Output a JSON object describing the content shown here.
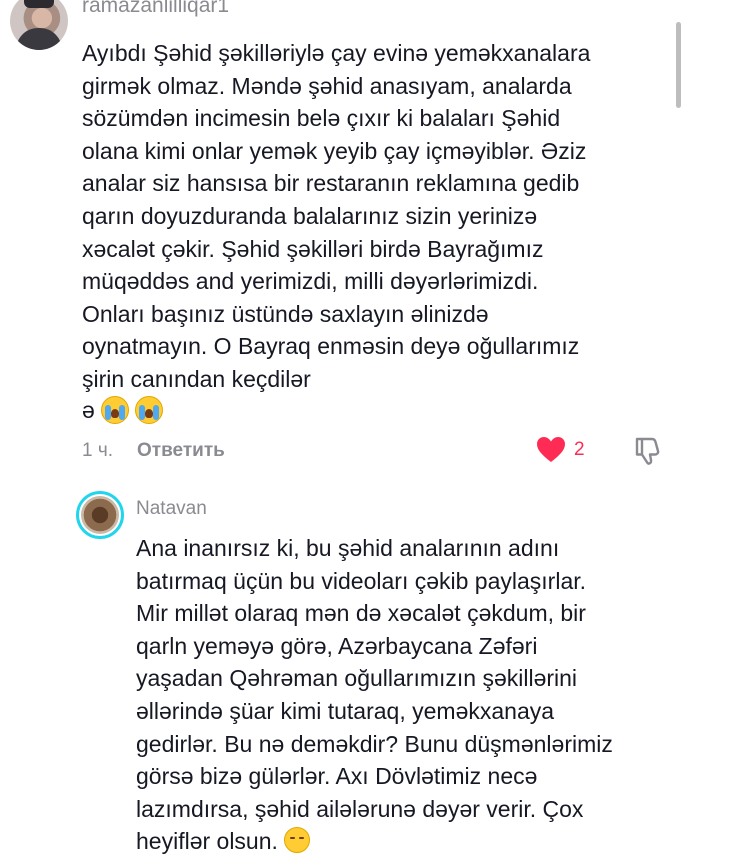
{
  "comment1": {
    "username": "ramazanlilliqar1",
    "lines": [
      "Ayıbdı Şəhid şəkilləriylə çay evinə yeməkxanalara",
      "girmək olmaz. Məndə şəhid anasıyam, analarda",
      "sözümdən incimesin belə çıxır ki balaları Şəhid",
      "olana kimi onlar yemək yeyib çay içməyiblər. Əziz",
      "analar siz hansısa bir restaranın reklamına gedib",
      "qarın doyuzduranda balalarınız sizin yerinizə",
      "xəcalət çəkir. Şəhid şəkilləri birdə Bayrağımız",
      "müqəddəs and yerimizdi, milli dəyərlərimizdi.",
      "Onları başınız üstündə saxlayın əlinizdə",
      "oynatmayın. O Bayraq enməsin deyə oğullarımız",
      "şirin canından keçdilər"
    ],
    "trailing_char": "ə",
    "time": "1 ч.",
    "reply_label": "Ответить",
    "like_count": "2"
  },
  "comment2": {
    "username": "Natavan",
    "lines": [
      "Ana inanırsız ki, bu şəhid analarının adını",
      "batırmaq üçün bu videoları çəkib paylaşırlar.",
      "Mir millət olaraq mən də xəcalət çəkdum, bir",
      "qarln yeməyə görə, Azərbaycana Zəfəri",
      "yaşadan Qəhrəman oğullarımızın şəkillərini",
      "əllərində şüar kimi tutaraq, yeməkxanaya",
      "gedirlər. Bu nə deməkdir? Bunu düşmənlərimiz",
      "görsə bizə gülərlər. Axı Dövlətimiz necə",
      "lazımdırsa, şəhid ailələrunə dəyər verir. Çox",
      "heyiflər olsun."
    ]
  },
  "colors": {
    "text": "#161823",
    "muted": "#8a8b91",
    "like_red": "#fe2c55",
    "avatar_ring": "#20d5ec"
  },
  "icons": {
    "like": "heart-icon",
    "dislike": "thumbs-down-icon",
    "crying": "loudly-crying-face-icon",
    "pensive": "pensive-face-icon"
  }
}
